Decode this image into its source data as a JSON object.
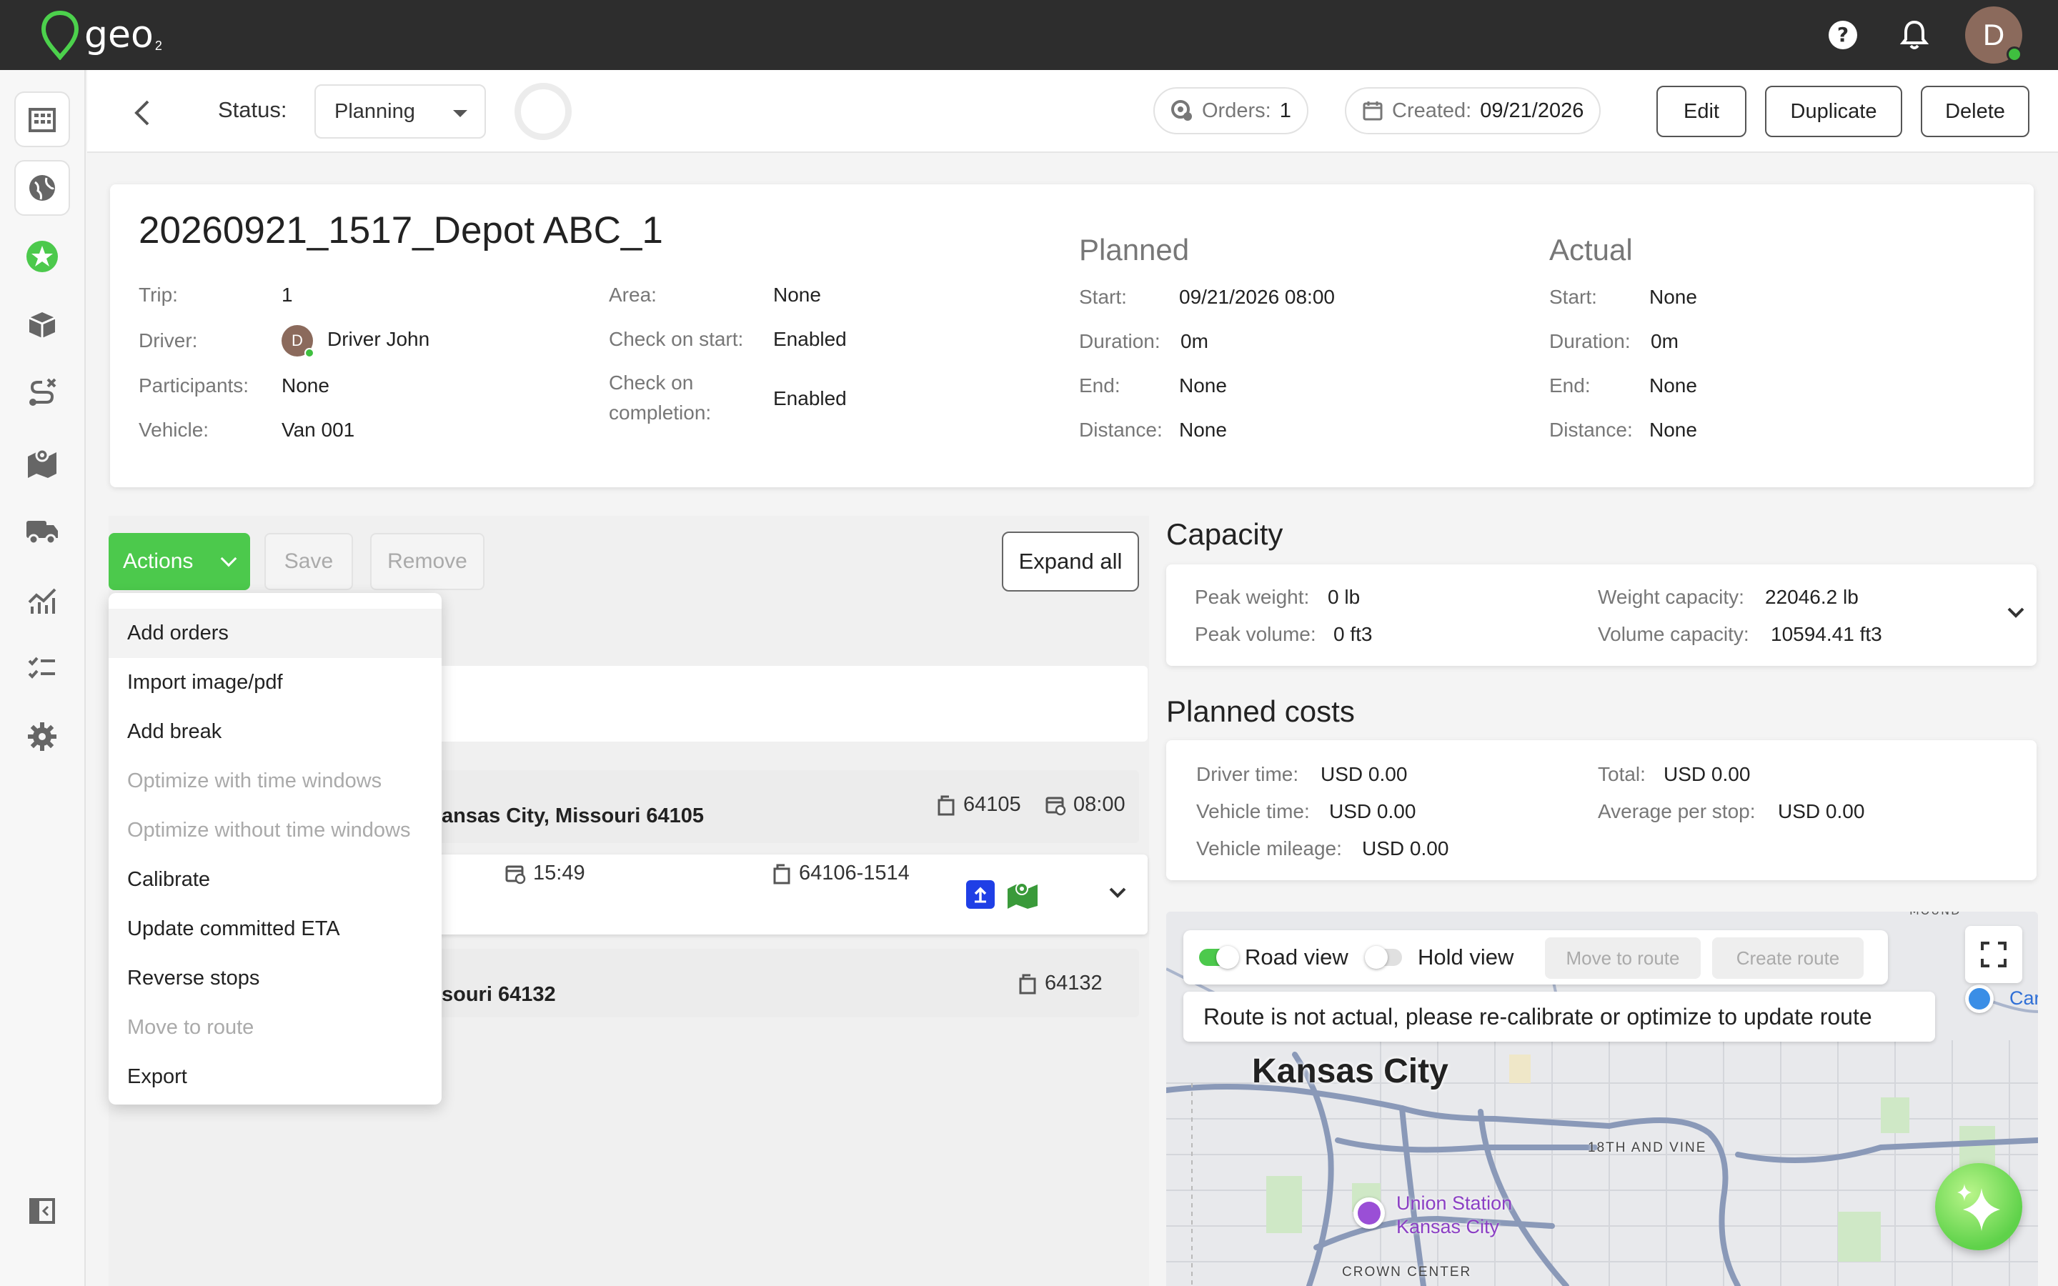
{
  "app": {
    "logo_text": "geo",
    "logo_sub": "2",
    "avatar_letter": "D"
  },
  "header": {
    "status_label": "Status:",
    "status_value": "Planning",
    "orders_label": "Orders:",
    "orders_value": "1",
    "created_label": "Created:",
    "created_value": "09/21/2026",
    "edit_label": "Edit",
    "duplicate_label": "Duplicate",
    "delete_label": "Delete"
  },
  "route": {
    "title": "20260921_1517_Depot ABC_1",
    "trip_label": "Trip:",
    "trip_value": "1",
    "driver_label": "Driver:",
    "driver_value": "Driver John",
    "driver_avatar": "D",
    "participants_label": "Participants:",
    "participants_value": "None",
    "vehicle_label": "Vehicle:",
    "vehicle_value": "Van 001",
    "area_label": "Area:",
    "area_value": "None",
    "check_start_label": "Check on start:",
    "check_start_value": "Enabled",
    "check_completion_label_1": "Check on",
    "check_completion_label_2": "completion:",
    "check_completion_value": "Enabled"
  },
  "planned": {
    "heading": "Planned",
    "start_label": "Start:",
    "start_value": "09/21/2026 08:00",
    "duration_label": "Duration:",
    "duration_value": "0m",
    "end_label": "End:",
    "end_value": "None",
    "distance_label": "Distance:",
    "distance_value": "None"
  },
  "actual": {
    "heading": "Actual",
    "start_label": "Start:",
    "start_value": "None",
    "duration_label": "Duration:",
    "duration_value": "0m",
    "end_label": "End:",
    "end_value": "None",
    "distance_label": "Distance:",
    "distance_value": "None"
  },
  "toolbar": {
    "actions_label": "Actions",
    "save_label": "Save",
    "remove_label": "Remove",
    "expand_all_label": "Expand all"
  },
  "actions_menu": [
    {
      "label": "Add orders",
      "disabled": false
    },
    {
      "label": "Import image/pdf",
      "disabled": false
    },
    {
      "label": "Add break",
      "disabled": false
    },
    {
      "label": "Optimize with time windows",
      "disabled": true
    },
    {
      "label": "Optimize without time windows",
      "disabled": true
    },
    {
      "label": "Calibrate",
      "disabled": false
    },
    {
      "label": "Update committed ETA",
      "disabled": false
    },
    {
      "label": "Reverse stops",
      "disabled": false
    },
    {
      "label": "Move to route",
      "disabled": true
    },
    {
      "label": "Export",
      "disabled": false
    }
  ],
  "stops": {
    "depot_address": "ansas City, Missouri 64105",
    "depot_zip": "64105",
    "depot_time": "08:00",
    "order_time": "15:49",
    "order_zip": "64106-1514",
    "end_address": "souri 64132",
    "end_zip": "64132"
  },
  "capacity": {
    "heading": "Capacity",
    "peak_weight_label": "Peak weight:",
    "peak_weight_value": "0 lb",
    "peak_volume_label": "Peak volume:",
    "peak_volume_value": "0 ft3",
    "weight_capacity_label": "Weight capacity:",
    "weight_capacity_value": "22046.2 lb",
    "volume_capacity_label": "Volume capacity:",
    "volume_capacity_value": "10594.41 ft3"
  },
  "costs": {
    "heading": "Planned costs",
    "driver_time_label": "Driver time:",
    "driver_time_value": "USD 0.00",
    "vehicle_time_label": "Vehicle time:",
    "vehicle_time_value": "USD 0.00",
    "vehicle_mileage_label": "Vehicle mileage:",
    "vehicle_mileage_value": "USD 0.00",
    "total_label": "Total:",
    "total_value": "USD 0.00",
    "avg_stop_label": "Average per stop:",
    "avg_stop_value": "USD 0.00"
  },
  "map": {
    "road_view_label": "Road view",
    "hold_view_label": "Hold view",
    "move_to_route_label": "Move to route",
    "create_route_label": "Create route",
    "notice": "Route is not actual, please re-calibrate or optimize to update route",
    "city_label": "Kansas City",
    "district_1": "18TH AND VINE",
    "district_2": "CROWN CENTER",
    "district_3": "MOUND",
    "poi_1": "Union Station",
    "poi_2": "Kansas City",
    "poi_3": "Car",
    "colors": {
      "accent": "#4cc94c",
      "road": "#8a99b8",
      "park": "#cfe8c6"
    }
  }
}
